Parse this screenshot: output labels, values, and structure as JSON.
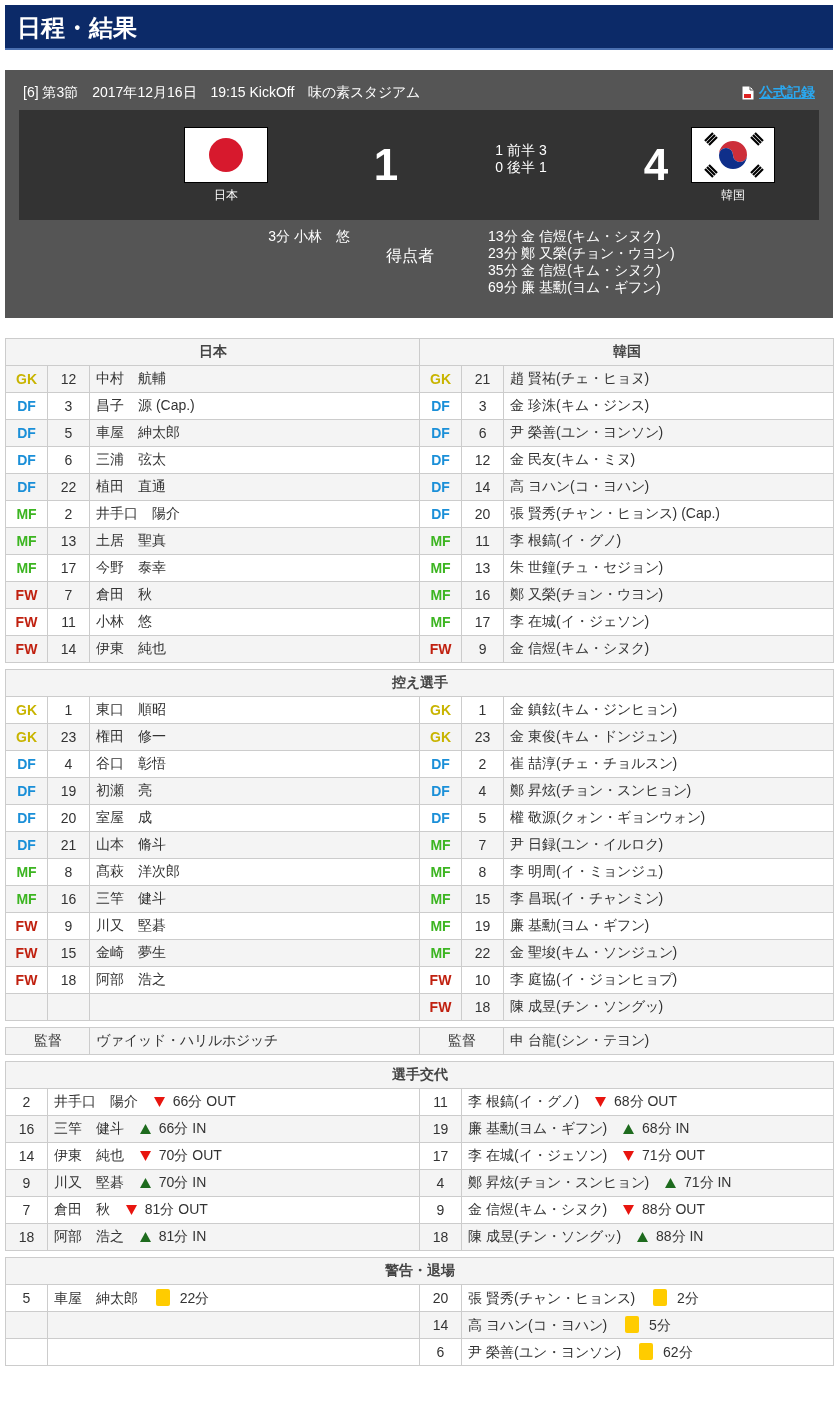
{
  "title": "日程・結果",
  "match": {
    "round": "[6]",
    "section": "第3節",
    "date": "2017年12月16日",
    "kickoff": "19:15 KickOff",
    "stadium": "味の素スタジアム",
    "record_link": "公式記録",
    "home": {
      "name": "日本",
      "score": "1"
    },
    "away": {
      "name": "韓国",
      "score": "4"
    },
    "halves": [
      {
        "home": "1",
        "label": "前半",
        "away": "3"
      },
      {
        "home": "0",
        "label": "後半",
        "away": "1"
      }
    ],
    "scorers_label": "得点者",
    "home_scorers": [
      "3分 小林　悠"
    ],
    "away_scorers": [
      "13分 金 信煜(キム・シヌク)",
      "23分 鄭 又榮(チョン・ウヨン)",
      "35分 金 信煜(キム・シヌク)",
      "69分 廉 基勳(ヨム・ギフン)"
    ]
  },
  "lineup": {
    "home_header": "日本",
    "away_header": "韓国",
    "starters": [
      {
        "home": {
          "pos": "GK",
          "color": "#c8b400",
          "num": "12",
          "name": "中村　航輔"
        },
        "away": {
          "pos": "GK",
          "color": "#c8b400",
          "num": "21",
          "name": "趙 賢祐(チェ・ヒョヌ)"
        }
      },
      {
        "home": {
          "pos": "DF",
          "color": "#1a8fd8",
          "num": "3",
          "name": "昌子　源 (Cap.)"
        },
        "away": {
          "pos": "DF",
          "color": "#1a8fd8",
          "num": "3",
          "name": "金 珍洙(キム・ジンス)"
        }
      },
      {
        "home": {
          "pos": "DF",
          "color": "#1a8fd8",
          "num": "5",
          "name": "車屋　紳太郎"
        },
        "away": {
          "pos": "DF",
          "color": "#1a8fd8",
          "num": "6",
          "name": "尹 榮善(ユン・ヨンソン)"
        }
      },
      {
        "home": {
          "pos": "DF",
          "color": "#1a8fd8",
          "num": "6",
          "name": "三浦　弦太"
        },
        "away": {
          "pos": "DF",
          "color": "#1a8fd8",
          "num": "12",
          "name": "金 民友(キム・ミヌ)"
        }
      },
      {
        "home": {
          "pos": "DF",
          "color": "#1a8fd8",
          "num": "22",
          "name": "植田　直通"
        },
        "away": {
          "pos": "DF",
          "color": "#1a8fd8",
          "num": "14",
          "name": "高 ヨハン(コ・ヨハン)"
        }
      },
      {
        "home": {
          "pos": "MF",
          "color": "#3cb521",
          "num": "2",
          "name": "井手口　陽介"
        },
        "away": {
          "pos": "DF",
          "color": "#1a8fd8",
          "num": "20",
          "name": "張 賢秀(チャン・ヒョンス) (Cap.)"
        }
      },
      {
        "home": {
          "pos": "MF",
          "color": "#3cb521",
          "num": "13",
          "name": "土居　聖真"
        },
        "away": {
          "pos": "MF",
          "color": "#3cb521",
          "num": "11",
          "name": "李 根鎬(イ・グノ)"
        }
      },
      {
        "home": {
          "pos": "MF",
          "color": "#3cb521",
          "num": "17",
          "name": "今野　泰幸"
        },
        "away": {
          "pos": "MF",
          "color": "#3cb521",
          "num": "13",
          "name": "朱 世鐘(チュ・セジョン)"
        }
      },
      {
        "home": {
          "pos": "FW",
          "color": "#c0200f",
          "num": "7",
          "name": "倉田　秋"
        },
        "away": {
          "pos": "MF",
          "color": "#3cb521",
          "num": "16",
          "name": "鄭 又榮(チョン・ウヨン)"
        }
      },
      {
        "home": {
          "pos": "FW",
          "color": "#c0200f",
          "num": "11",
          "name": "小林　悠"
        },
        "away": {
          "pos": "MF",
          "color": "#3cb521",
          "num": "17",
          "name": "李 在城(イ・ジェソン)"
        }
      },
      {
        "home": {
          "pos": "FW",
          "color": "#c0200f",
          "num": "14",
          "name": "伊東　純也"
        },
        "away": {
          "pos": "FW",
          "color": "#c0200f",
          "num": "9",
          "name": "金 信煜(キム・シヌク)"
        }
      }
    ],
    "subs_header": "控え選手",
    "subs": [
      {
        "home": {
          "pos": "GK",
          "color": "#c8b400",
          "num": "1",
          "name": "東口　順昭"
        },
        "away": {
          "pos": "GK",
          "color": "#c8b400",
          "num": "1",
          "name": "金 鎮鉉(キム・ジンヒョン)"
        }
      },
      {
        "home": {
          "pos": "GK",
          "color": "#c8b400",
          "num": "23",
          "name": "権田　修一"
        },
        "away": {
          "pos": "GK",
          "color": "#c8b400",
          "num": "23",
          "name": "金 東俊(キム・ドンジュン)"
        }
      },
      {
        "home": {
          "pos": "DF",
          "color": "#1a8fd8",
          "num": "4",
          "name": "谷口　彰悟"
        },
        "away": {
          "pos": "DF",
          "color": "#1a8fd8",
          "num": "2",
          "name": "崔 喆淳(チェ・チョルスン)"
        }
      },
      {
        "home": {
          "pos": "DF",
          "color": "#1a8fd8",
          "num": "19",
          "name": "初瀬　亮"
        },
        "away": {
          "pos": "DF",
          "color": "#1a8fd8",
          "num": "4",
          "name": "鄭 昇炫(チョン・スンヒョン)"
        }
      },
      {
        "home": {
          "pos": "DF",
          "color": "#1a8fd8",
          "num": "20",
          "name": "室屋　成"
        },
        "away": {
          "pos": "DF",
          "color": "#1a8fd8",
          "num": "5",
          "name": "權 敬源(クォン・ギョンウォン)"
        }
      },
      {
        "home": {
          "pos": "DF",
          "color": "#1a8fd8",
          "num": "21",
          "name": "山本　脩斗"
        },
        "away": {
          "pos": "MF",
          "color": "#3cb521",
          "num": "7",
          "name": "尹 日録(ユン・イルロク)"
        }
      },
      {
        "home": {
          "pos": "MF",
          "color": "#3cb521",
          "num": "8",
          "name": "髙萩　洋次郎"
        },
        "away": {
          "pos": "MF",
          "color": "#3cb521",
          "num": "8",
          "name": "李 明周(イ・ミョンジュ)"
        }
      },
      {
        "home": {
          "pos": "MF",
          "color": "#3cb521",
          "num": "16",
          "name": "三竿　健斗"
        },
        "away": {
          "pos": "MF",
          "color": "#3cb521",
          "num": "15",
          "name": "李 昌珉(イ・チャンミン)"
        }
      },
      {
        "home": {
          "pos": "FW",
          "color": "#c0200f",
          "num": "9",
          "name": "川又　堅碁"
        },
        "away": {
          "pos": "MF",
          "color": "#3cb521",
          "num": "19",
          "name": "廉 基勳(ヨム・ギフン)"
        }
      },
      {
        "home": {
          "pos": "FW",
          "color": "#c0200f",
          "num": "15",
          "name": "金崎　夢生"
        },
        "away": {
          "pos": "MF",
          "color": "#3cb521",
          "num": "22",
          "name": "金 聖埈(キム・ソンジュン)"
        }
      },
      {
        "home": {
          "pos": "FW",
          "color": "#c0200f",
          "num": "18",
          "name": "阿部　浩之"
        },
        "away": {
          "pos": "FW",
          "color": "#c0200f",
          "num": "10",
          "name": "李 庭協(イ・ジョンヒョプ)"
        }
      },
      {
        "away": {
          "pos": "FW",
          "color": "#c0200f",
          "num": "18",
          "name": "陳 成昱(チン・ソングッ)"
        }
      }
    ],
    "managers": {
      "home": {
        "label": "監督",
        "name": "ヴァイッド・ハリルホジッチ"
      },
      "away": {
        "label": "監督",
        "name": "申 台龍(シン・テヨン)"
      }
    }
  },
  "substitutions": {
    "header": "選手交代",
    "rows": [
      {
        "home": {
          "num": "2",
          "name": "井手口　陽介",
          "kind": "out",
          "time": "66分 OUT"
        },
        "away": {
          "num": "11",
          "name": "李 根鎬(イ・グノ)",
          "kind": "out",
          "time": "68分 OUT"
        }
      },
      {
        "home": {
          "num": "16",
          "name": "三竿　健斗",
          "kind": "in",
          "time": "66分 IN"
        },
        "away": {
          "num": "19",
          "name": "廉 基勳(ヨム・ギフン)",
          "kind": "in",
          "time": "68分 IN"
        }
      },
      {
        "home": {
          "num": "14",
          "name": "伊東　純也",
          "kind": "out",
          "time": "70分 OUT"
        },
        "away": {
          "num": "17",
          "name": "李 在城(イ・ジェソン)",
          "kind": "out",
          "time": "71分 OUT"
        }
      },
      {
        "home": {
          "num": "9",
          "name": "川又　堅碁",
          "kind": "in",
          "time": "70分 IN"
        },
        "away": {
          "num": "4",
          "name": "鄭 昇炫(チョン・スンヒョン)",
          "kind": "in",
          "time": "71分 IN"
        }
      },
      {
        "home": {
          "num": "7",
          "name": "倉田　秋",
          "kind": "out",
          "time": "81分 OUT"
        },
        "away": {
          "num": "9",
          "name": "金 信煜(キム・シヌク)",
          "kind": "out",
          "time": "88分 OUT"
        }
      },
      {
        "home": {
          "num": "18",
          "name": "阿部　浩之",
          "kind": "in",
          "time": "81分 IN"
        },
        "away": {
          "num": "18",
          "name": "陳 成昱(チン・ソングッ)",
          "kind": "in",
          "time": "88分 IN"
        }
      }
    ]
  },
  "cards": {
    "header": "警告・退場",
    "rows": [
      {
        "home": {
          "num": "5",
          "name": "車屋　紳太郎",
          "kind": "yellow",
          "time": "22分"
        },
        "away": {
          "num": "20",
          "name": "張 賢秀(チャン・ヒョンス)",
          "kind": "yellow",
          "time": "2分"
        }
      },
      {
        "away": {
          "num": "14",
          "name": "高 ヨハン(コ・ヨハン)",
          "kind": "yellow",
          "time": "5分"
        }
      },
      {
        "away": {
          "num": "6",
          "name": "尹 榮善(ユン・ヨンソン)",
          "kind": "yellow",
          "time": "62分"
        }
      }
    ]
  }
}
